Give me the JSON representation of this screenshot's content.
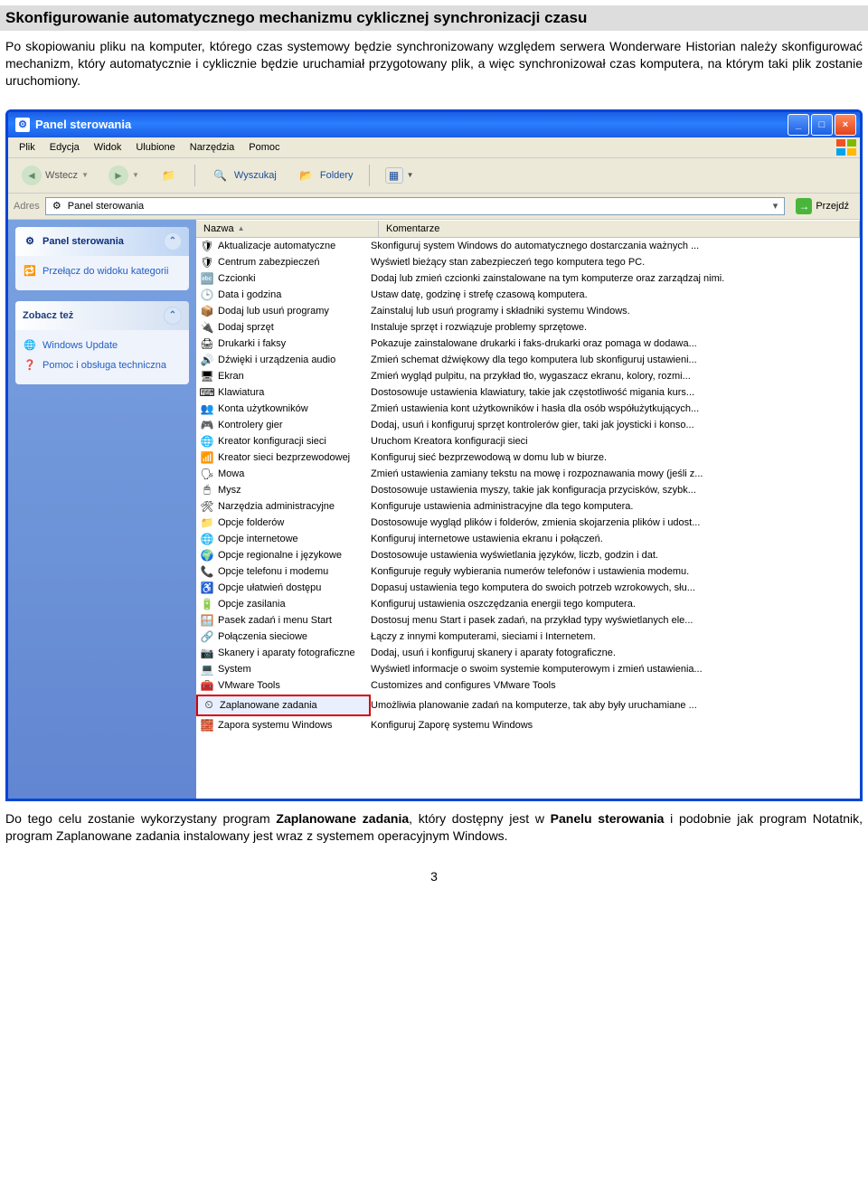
{
  "doc_heading": "Skonfigurowanie automatycznego mechanizmu cyklicznej synchronizacji czasu",
  "doc_intro": "Po skopiowaniu pliku na komputer, którego czas systemowy będzie synchronizowany względem serwera Wonderware Historian należy skonfigurować mechanizm, który automatycznie i cyklicznie będzie uruchamiał przygotowany plik, a więc synchronizował czas komputera, na którym taki plik zostanie uruchomiony.",
  "window": {
    "title": "Panel sterowania",
    "menu": [
      "Plik",
      "Edycja",
      "Widok",
      "Ulubione",
      "Narzędzia",
      "Pomoc"
    ],
    "toolbar": {
      "back": "Wstecz",
      "search": "Wyszukaj",
      "folders": "Foldery"
    },
    "address": {
      "label": "Adres",
      "value": "Panel sterowania",
      "go": "Przejdź"
    },
    "sidebar": {
      "panel1": {
        "title": "Panel sterowania",
        "link": "Przełącz do widoku kategorii"
      },
      "panel2": {
        "title": "Zobacz też",
        "links": [
          "Windows Update",
          "Pomoc i obsługa techniczna"
        ]
      }
    },
    "columns": {
      "name": "Nazwa",
      "comment": "Komentarze"
    },
    "items": [
      {
        "name": "Aktualizacje automatyczne",
        "comment": "Skonfiguruj system Windows do automatycznego dostarczania ważnych ..."
      },
      {
        "name": "Centrum zabezpieczeń",
        "comment": "Wyświetl bieżący stan zabezpieczeń tego komputera tego PC."
      },
      {
        "name": "Czcionki",
        "comment": "Dodaj lub zmień czcionki zainstalowane na tym komputerze oraz zarządzaj nimi."
      },
      {
        "name": "Data i godzina",
        "comment": "Ustaw datę, godzinę i strefę czasową komputera."
      },
      {
        "name": "Dodaj lub usuń programy",
        "comment": "Zainstaluj lub usuń programy i składniki systemu Windows."
      },
      {
        "name": "Dodaj sprzęt",
        "comment": "Instaluje sprzęt i rozwiązuje problemy sprzętowe."
      },
      {
        "name": "Drukarki i faksy",
        "comment": "Pokazuje zainstalowane drukarki i faks-drukarki oraz pomaga w dodawa..."
      },
      {
        "name": "Dźwięki i urządzenia audio",
        "comment": "Zmień schemat dźwiękowy dla tego komputera lub skonfiguruj ustawieni..."
      },
      {
        "name": "Ekran",
        "comment": "Zmień wygląd pulpitu, na przykład tło, wygaszacz ekranu, kolory, rozmi..."
      },
      {
        "name": "Klawiatura",
        "comment": "Dostosowuje ustawienia klawiatury, takie jak częstotliwość migania kurs..."
      },
      {
        "name": "Konta użytkowników",
        "comment": "Zmień ustawienia kont użytkowników i hasła dla osób współużytkujących..."
      },
      {
        "name": "Kontrolery gier",
        "comment": "Dodaj, usuń i konfiguruj sprzęt kontrolerów gier, taki jak joysticki i konso..."
      },
      {
        "name": "Kreator konfiguracji sieci",
        "comment": "Uruchom Kreatora konfiguracji sieci"
      },
      {
        "name": "Kreator sieci bezprzewodowej",
        "comment": "Konfiguruj sieć bezprzewodową w domu lub w biurze."
      },
      {
        "name": "Mowa",
        "comment": "Zmień ustawienia zamiany tekstu na mowę i rozpoznawania mowy (jeśli z..."
      },
      {
        "name": "Mysz",
        "comment": "Dostosowuje ustawienia myszy, takie jak konfiguracja przycisków, szybk..."
      },
      {
        "name": "Narzędzia administracyjne",
        "comment": "Konfiguruje ustawienia administracyjne dla tego komputera."
      },
      {
        "name": "Opcje folderów",
        "comment": "Dostosowuje wygląd plików i folderów, zmienia skojarzenia plików i udost..."
      },
      {
        "name": "Opcje internetowe",
        "comment": "Konfiguruj internetowe ustawienia ekranu i połączeń."
      },
      {
        "name": "Opcje regionalne i językowe",
        "comment": "Dostosowuje ustawienia wyświetlania języków, liczb, godzin i dat."
      },
      {
        "name": "Opcje telefonu i modemu",
        "comment": "Konfiguruje reguły wybierania numerów telefonów i ustawienia modemu."
      },
      {
        "name": "Opcje ułatwień dostępu",
        "comment": "Dopasuj ustawienia tego komputera do swoich potrzeb wzrokowych, słu..."
      },
      {
        "name": "Opcje zasilania",
        "comment": "Konfiguruj ustawienia oszczędzania energii tego komputera."
      },
      {
        "name": "Pasek zadań i menu Start",
        "comment": "Dostosuj menu Start i pasek zadań, na przykład typy wyświetlanych ele..."
      },
      {
        "name": "Połączenia sieciowe",
        "comment": "Łączy z innymi komputerami, sieciami i Internetem."
      },
      {
        "name": "Skanery i aparaty fotograficzne",
        "comment": "Dodaj, usuń i konfiguruj skanery i aparaty fotograficzne."
      },
      {
        "name": "System",
        "comment": "Wyświetl informacje o swoim systemie komputerowym i zmień ustawienia..."
      },
      {
        "name": "VMware Tools",
        "comment": "Customizes and configures VMware Tools"
      },
      {
        "name": "Zaplanowane zadania",
        "comment": "Umożliwia planowanie zadań na komputerze, tak aby były uruchamiane ...",
        "highlight": true
      },
      {
        "name": "Zapora systemu Windows",
        "comment": "Konfiguruj Zaporę systemu Windows"
      }
    ]
  },
  "post_text_pre": "Do tego celu zostanie wykorzystany program ",
  "post_text_b1": "Zaplanowane zadania",
  "post_text_mid": ", który dostępny jest w ",
  "post_text_b2": "Panelu sterowania",
  "post_text_end": " i podobnie jak program Notatnik, program Zaplanowane zadania instalowany jest wraz z systemem operacyjnym Windows.",
  "page_number": "3"
}
